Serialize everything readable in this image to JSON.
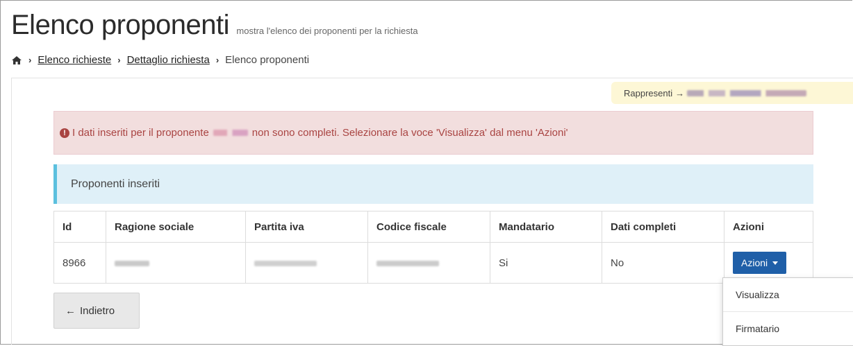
{
  "header": {
    "title": "Elenco proponenti",
    "subtitle": "mostra l'elenco dei proponenti per la richiesta"
  },
  "breadcrumb": {
    "home_icon": "home-icon",
    "items": [
      "Elenco richieste",
      "Dettaglio richiesta",
      "Elenco proponenti"
    ]
  },
  "represent": {
    "label": "Rappresenti"
  },
  "alert": {
    "text_before": "I dati inseriti per il proponente",
    "text_after": "non sono completi. Selezionare la voce 'Visualizza' dal menu 'Azioni'"
  },
  "panel": {
    "title": "Proponenti inseriti"
  },
  "table": {
    "columns": [
      "Id",
      "Ragione sociale",
      "Partita iva",
      "Codice fiscale",
      "Mandatario",
      "Dati completi",
      "Azioni"
    ],
    "rows": [
      {
        "id": "8966",
        "mandatario": "Si",
        "dati_completi": "No",
        "azioni_label": "Azioni"
      }
    ]
  },
  "dropdown": {
    "items": [
      "Visualizza",
      "Firmatario"
    ]
  },
  "back_button": {
    "label": "Indietro"
  },
  "colors": {
    "primary_button": "#1f5fa8",
    "alert_bg": "#f2dede",
    "alert_text": "#a94442",
    "panel_bg": "#dff0f8",
    "panel_accent": "#5bc0de",
    "represent_bg": "#fdf7d6"
  }
}
